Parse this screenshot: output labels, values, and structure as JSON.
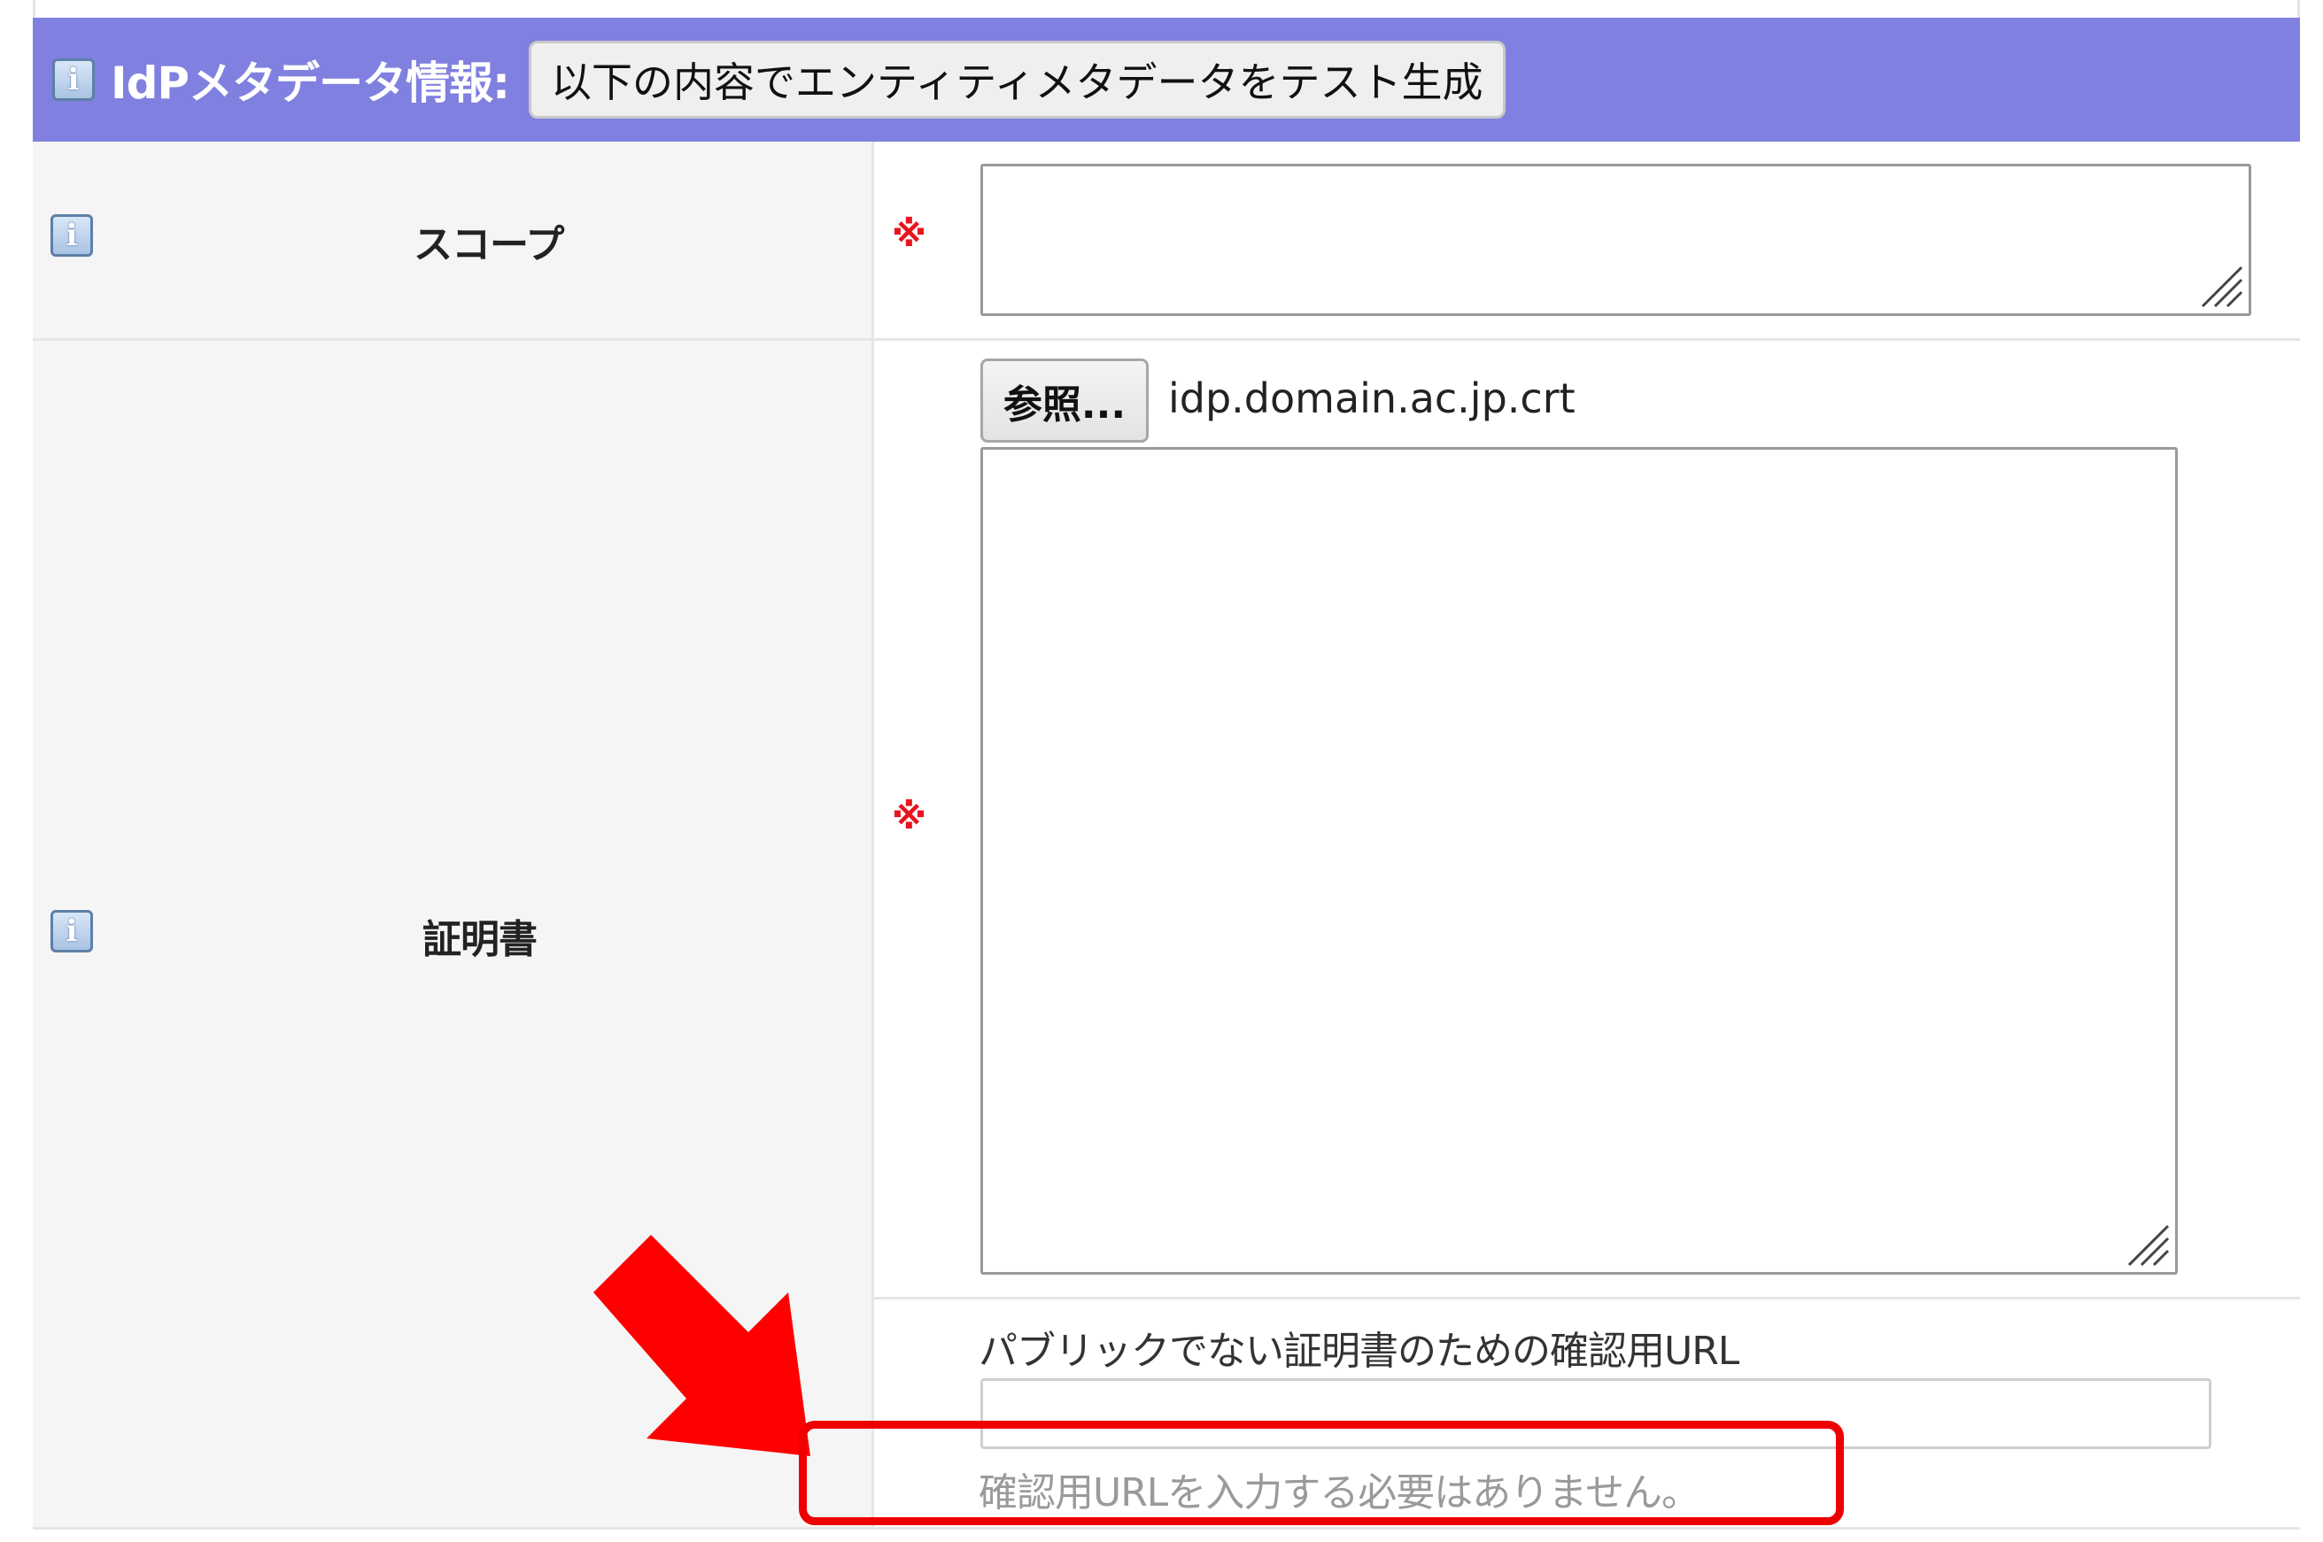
{
  "header": {
    "title": "IdPメタデータ情報:",
    "button_label": "以下の内容でエンティティメタデータをテスト生成",
    "background_color": "#8080e0"
  },
  "scope_row": {
    "label": "スコープ",
    "required_mark": "※",
    "textarea_value": ""
  },
  "cert_row": {
    "label": "証明書",
    "required_mark": "※",
    "browse_button_label": "参照...",
    "file_name": "idp.domain.ac.jp.crt",
    "textarea_value": "",
    "url_label": "パブリックでない証明書のための確認用URL",
    "url_value": "",
    "note": "確認用URLを入力する必要はありません。"
  },
  "icons": {
    "info": "info-icon",
    "info_glyph": "i",
    "arrow": "red-arrow-annotation",
    "highlight": "red-highlight-box"
  },
  "colors": {
    "required": "#e8141e",
    "annotation": "#ee0000"
  }
}
